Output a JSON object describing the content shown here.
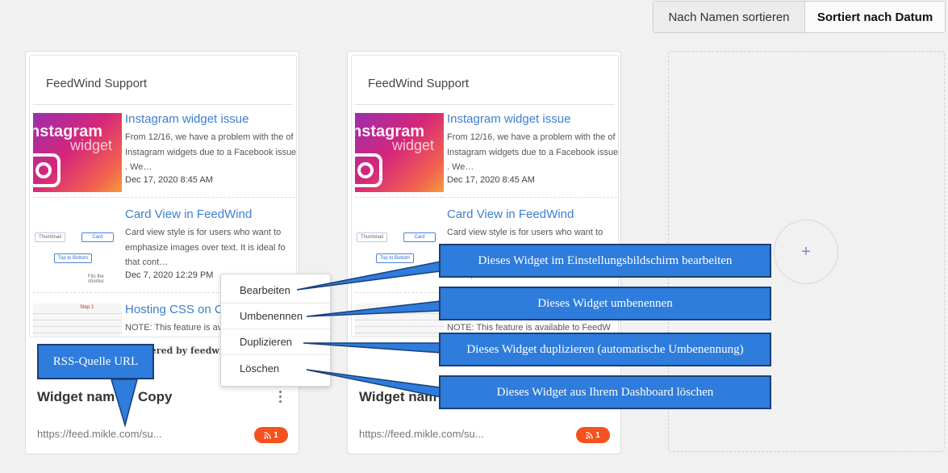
{
  "sort": {
    "by_name": "Nach Namen sortieren",
    "by_date": "Sortiert nach Datum"
  },
  "preview": {
    "title": "FeedWind Support",
    "items": [
      {
        "title": "Instagram widget issue",
        "desc": "From 12/16, we have a problem with the of Instagram widgets due to a Facebook issue . We…",
        "date": "Dec 17, 2020 8:45 AM",
        "thumb_text": "nstagram",
        "thumb_text2": "widget"
      },
      {
        "title": "Card View in FeedWind",
        "desc": "Card view style is for users who want to emphasize images over text. It is ideal fo that cont…",
        "date": "Dec 7, 2020 12:29 PM",
        "thumb_labels": [
          "Thumbnail",
          "Card",
          "Top to Bottom",
          "Fits the shortes"
        ]
      },
      {
        "title": "Hosting CSS on C",
        "desc": "NOTE: This feature is available to FeedW",
        "date": "",
        "thumb_label": "Step 1"
      }
    ],
    "powered": "Powered by feedwind"
  },
  "widgets": [
    {
      "name": "Widget nam",
      "name_suffix": "Copy",
      "url": "https://feed.mikle.com/su...",
      "badge": "1"
    },
    {
      "name": "Widget nam",
      "url": "https://feed.mikle.com/su...",
      "badge": "1"
    }
  ],
  "add_icon": "+",
  "menu": {
    "edit": "Bearbeiten",
    "rename": "Umbenennen",
    "duplicate": "Duplizieren",
    "delete": "Löschen"
  },
  "callouts": {
    "rss": "RSS-Quelle URL",
    "edit": "Dieses Widget im Einstellungsbildschirm bearbeiten",
    "rename": "Dieses Widget umbenennen",
    "duplicate": "Dieses Widget duplizieren (automatische Umbenennung)",
    "delete": "Dieses Widget aus Ihrem Dashboard löschen"
  },
  "colors": {
    "accent": "#2e7cdb",
    "badge": "#f4511e",
    "link": "#3b7fd0"
  }
}
